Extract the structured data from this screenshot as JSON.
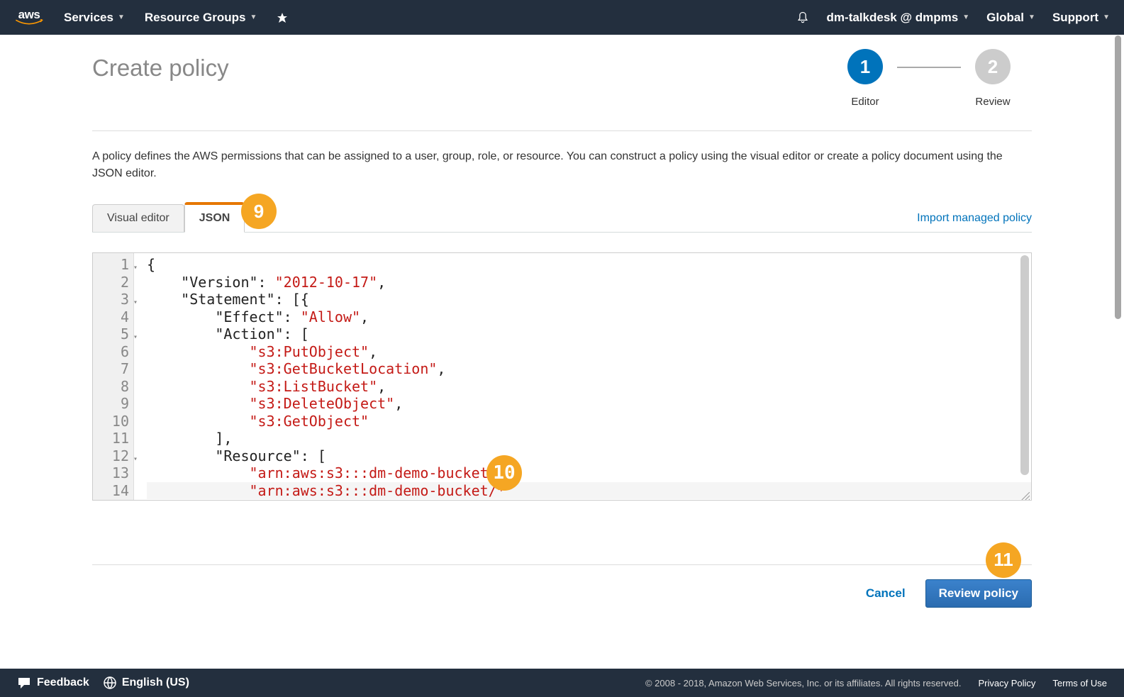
{
  "nav": {
    "logo_text": "aws",
    "services": "Services",
    "resource_groups": "Resource Groups",
    "account": "dm-talkdesk @ dmpms",
    "region": "Global",
    "support": "Support"
  },
  "page": {
    "title": "Create policy",
    "description": "A policy defines the AWS permissions that can be assigned to a user, group, role, or resource. You can construct a policy using the visual editor or create a policy document using the JSON editor."
  },
  "stepper": {
    "step1_num": "1",
    "step1_label": "Editor",
    "step2_num": "2",
    "step2_label": "Review"
  },
  "tabs": {
    "visual_editor": "Visual editor",
    "json": "JSON",
    "import_link": "Import managed policy"
  },
  "editor": {
    "line_numbers": [
      "1",
      "2",
      "3",
      "4",
      "5",
      "6",
      "7",
      "8",
      "9",
      "10",
      "11",
      "12",
      "13",
      "14"
    ],
    "policy": {
      "Version": "2012-10-17",
      "Statement": [
        {
          "Effect": "Allow",
          "Action": [
            "s3:PutObject",
            "s3:GetBucketLocation",
            "s3:ListBucket",
            "s3:DeleteObject",
            "s3:GetObject"
          ],
          "Resource": [
            "arn:aws:s3:::dm-demo-bucket",
            "arn:aws:s3:::dm-demo-bucket/*"
          ]
        }
      ]
    },
    "tok": {
      "version_key": "\"Version\"",
      "version_val": "\"2012-10-17\"",
      "statement_key": "\"Statement\"",
      "effect_key": "\"Effect\"",
      "effect_val": "\"Allow\"",
      "action_key": "\"Action\"",
      "a1": "\"s3:PutObject\"",
      "a2": "\"s3:GetBucketLocation\"",
      "a3": "\"s3:ListBucket\"",
      "a4": "\"s3:DeleteObject\"",
      "a5": "\"s3:GetObject\"",
      "resource_key": "\"Resource\"",
      "r1": "\"arn:aws:s3:::dm-demo-bucket\"",
      "r2": "\"arn:aws:s3:::dm-demo-bucket/*\""
    }
  },
  "annotations": {
    "a9": "9",
    "a10": "10",
    "a11": "11"
  },
  "actions": {
    "cancel": "Cancel",
    "review": "Review policy"
  },
  "footer": {
    "feedback": "Feedback",
    "language": "English (US)",
    "copyright": "© 2008 - 2018, Amazon Web Services, Inc. or its affiliates. All rights reserved.",
    "privacy": "Privacy Policy",
    "terms": "Terms of Use"
  }
}
